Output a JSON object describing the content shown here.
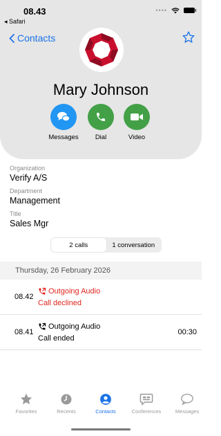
{
  "status_bar": {
    "time": "08.43",
    "back_app": "◂ Safari"
  },
  "nav": {
    "back_label": "Contacts"
  },
  "contact": {
    "name": "Mary Johnson"
  },
  "actions": [
    {
      "label": "Messages",
      "color": "#2196f3"
    },
    {
      "label": "Dial",
      "color": "#43a047"
    },
    {
      "label": "Video",
      "color": "#43a047"
    }
  ],
  "fields": [
    {
      "label": "Organization",
      "value": "Verify A/S"
    },
    {
      "label": "Department",
      "value": "Management"
    },
    {
      "label": "Title",
      "value": "Sales Mgr"
    }
  ],
  "segments": {
    "calls": "2 calls",
    "conversations": "1 conversation",
    "active": "calls"
  },
  "history": {
    "date": "Thursday, 26 February 2026",
    "calls": [
      {
        "time": "08.42",
        "type": "Outgoing Audio",
        "status": "Call declined",
        "duration": "",
        "declined": true
      },
      {
        "time": "08.41",
        "type": "Outgoing Audio",
        "status": "Call ended",
        "duration": "00:30",
        "declined": false
      }
    ]
  },
  "tabs": [
    {
      "label": "Favorites",
      "icon": "star-icon"
    },
    {
      "label": "Recents",
      "icon": "clock-icon"
    },
    {
      "label": "Contacts",
      "icon": "person-icon",
      "active": true
    },
    {
      "label": "Conferences",
      "icon": "conference-icon"
    },
    {
      "label": "Messages",
      "icon": "chat-bubble-icon"
    }
  ],
  "colors": {
    "accent": "#1a73e8",
    "declined": "#e0251e",
    "logo": "#c8102e"
  }
}
